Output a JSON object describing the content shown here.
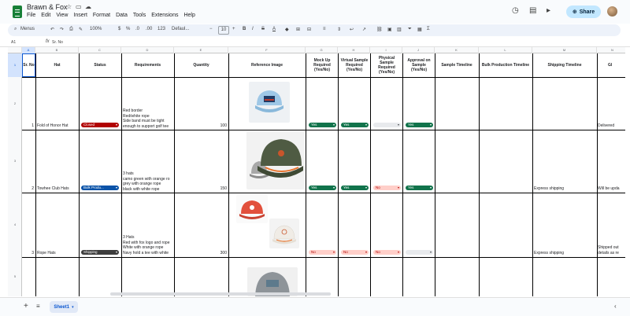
{
  "app": {
    "doc_title": "Brawn & Fox",
    "menu": [
      "File",
      "Edit",
      "View",
      "Insert",
      "Format",
      "Data",
      "Tools",
      "Extensions",
      "Help"
    ],
    "share_label": "Share"
  },
  "toolbar": {
    "menus_label": "Menus",
    "zoom": "100%",
    "currency": "$",
    "percent": "%",
    "dec_decrease": ".0",
    "dec_increase": ".00",
    "format_123": "123",
    "font": "Defaul...",
    "font_size": "10"
  },
  "formula": {
    "cell_ref": "A1",
    "fx": "fx",
    "value": "Sr. No"
  },
  "sheet": {
    "columns": [
      "A",
      "B",
      "C",
      "D",
      "E",
      "F",
      "G",
      "H",
      "I",
      "J",
      "K",
      "L",
      "M",
      "N"
    ],
    "rows": [
      "1",
      "2",
      "3",
      "4",
      "5"
    ],
    "headers": {
      "sr_no": "Sr. No",
      "hat": "Hat",
      "status": "Status",
      "requirements": "Requirements",
      "quantity": "Quantity",
      "reference_image": "Reference Image",
      "mock_up": "Mock Up Required (Yes/No)",
      "virtual_sample": "Virtual Sample Required (Yes/No)",
      "physical_sample": "Physical Sample Required (Yes/No)",
      "approval": "Approval on Sample (Yes/No)",
      "sample_timeline": "Sample Timeline",
      "bulk_timeline": "Bulk Production Timeline",
      "shipping_timeline": "Shipping Timeline",
      "gl": "Gl"
    },
    "data": [
      {
        "sr": "1",
        "hat": "Fold of Honor Hat",
        "status": "Closed",
        "req": [
          "Red border",
          "Red/white rope",
          "Side band must be tight",
          "enough to support golf tee"
        ],
        "qty": "100",
        "mock": "Yes",
        "virtual": "Yes",
        "physical": "",
        "approval": "Yes",
        "shipping": "",
        "gl": "Delivered"
      },
      {
        "sr": "2",
        "hat": "Towhee Club Hats",
        "status": "Bulk Produ...",
        "req": [
          "3 hats",
          "camo green with orange ro",
          "grey with orange rope",
          "black with white rope"
        ],
        "qty": "150",
        "mock": "Yes",
        "virtual": "Yes",
        "physical": "No",
        "approval": "Yes",
        "shipping": "Express shipping",
        "gl": "Will be upda"
      },
      {
        "sr": "3",
        "hat": "Rope Hats",
        "status": "Shipping",
        "req": [
          "3 Hats",
          "Red with fox logo and rope",
          "White with orange rope",
          "Navy hold a tee with white"
        ],
        "qty": "300",
        "mock": "No",
        "virtual": "No",
        "physical": "No",
        "approval": "",
        "shipping": "Express shipping",
        "gl": [
          "Shipped out",
          "details as re"
        ]
      }
    ]
  },
  "bottom": {
    "sheet_tab": "Sheet1"
  },
  "colors": {
    "green_chip": "#11734b",
    "peach_chip": "#ffcfc9",
    "closed_chip": "#b10202",
    "bulk_chip": "#0a53a8",
    "shipping_chip": "#3d3d3d",
    "share_bg": "#c2e7ff"
  }
}
